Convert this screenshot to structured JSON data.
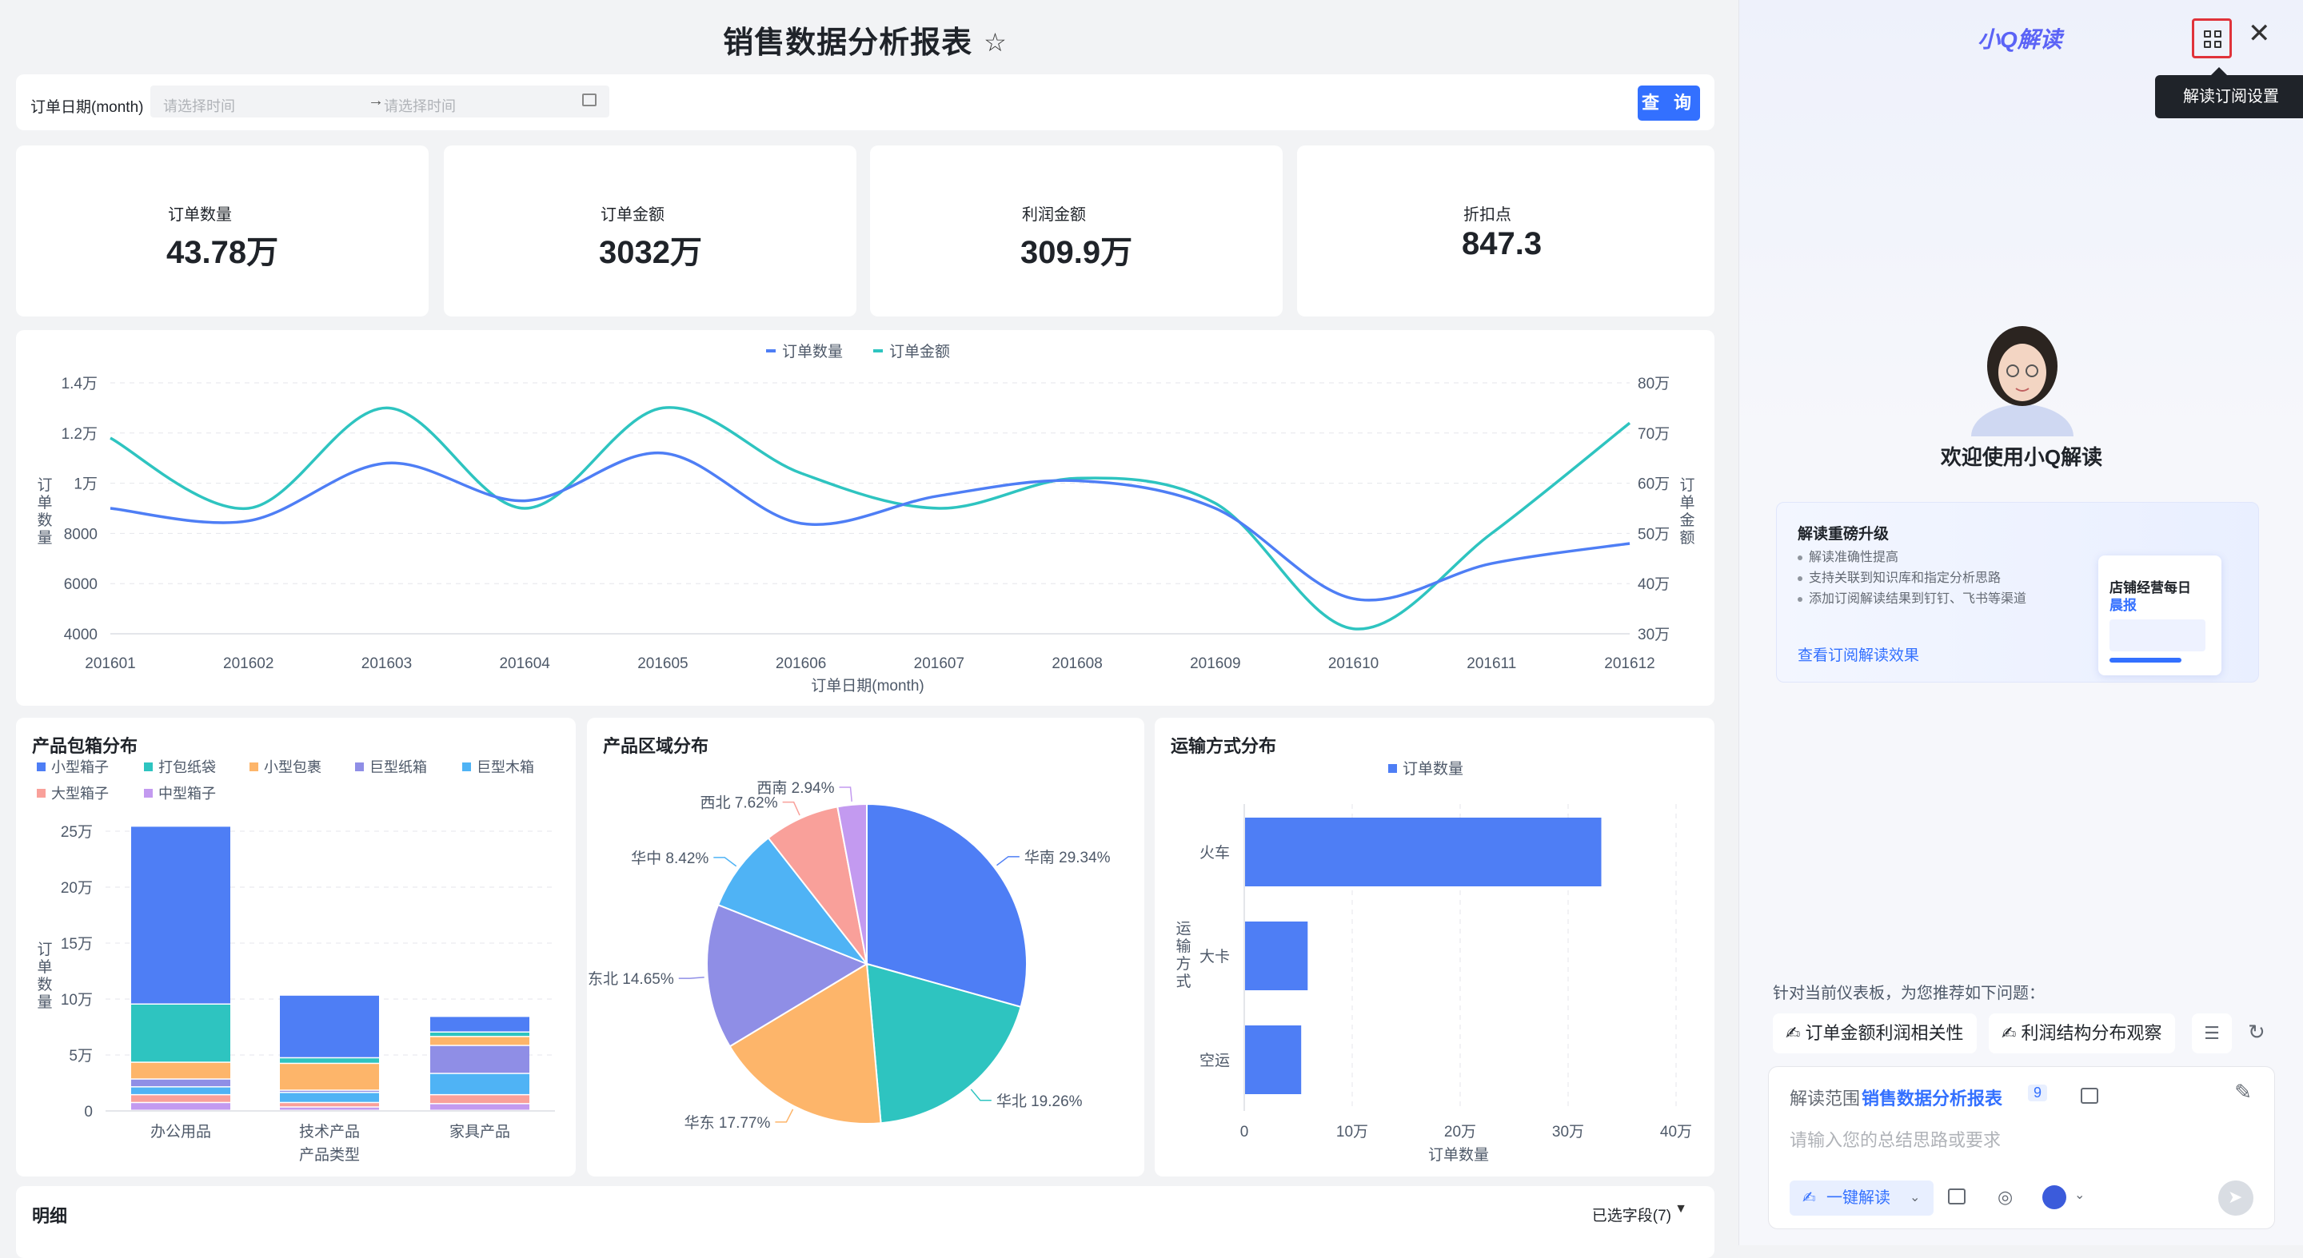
{
  "page": {
    "title": "销售数据分析报表"
  },
  "filter": {
    "label": "订单日期(month)",
    "start_placeholder": "请选择时间",
    "end_placeholder": "请选择时间",
    "query_label": "查 询"
  },
  "kpis": [
    {
      "label": "订单数量",
      "value": "43.78万"
    },
    {
      "label": "订单金额",
      "value": "3032万"
    },
    {
      "label": "利润金额",
      "value": "309.9万"
    },
    {
      "label": "折扣点",
      "value": "847.3"
    }
  ],
  "line_chart": {
    "legend": [
      "订单数量",
      "订单金额"
    ],
    "xlabel": "订单日期(month)",
    "ylabel_left": "订单数量",
    "ylabel_right": "订单金额",
    "xticks": [
      "201601",
      "201602",
      "201603",
      "201604",
      "201605",
      "201606",
      "201607",
      "201608",
      "201609",
      "201610",
      "201611",
      "201612"
    ],
    "yticks_left": [
      "1.4万",
      "1.2万",
      "1万",
      "8000",
      "6000",
      "4000"
    ],
    "yticks_right": [
      "80万",
      "70万",
      "60万",
      "50万",
      "40万",
      "30万"
    ]
  },
  "bar_chart": {
    "title": "产品包箱分布",
    "legend": [
      "小型箱子",
      "打包纸袋",
      "小型包裹",
      "巨型纸箱",
      "巨型木箱",
      "大型箱子",
      "中型箱子"
    ],
    "categories": [
      "办公用品",
      "技术产品",
      "家具产品"
    ],
    "xlabel": "产品类型",
    "ylabel": "订单数量",
    "yticks": [
      "25万",
      "20万",
      "15万",
      "10万",
      "5万",
      "0"
    ]
  },
  "pie_chart": {
    "title": "产品区域分布",
    "labels": [
      "华南 29.34%",
      "华北 19.26%",
      "华东 17.77%",
      "东北 14.65%",
      "华中 8.42%",
      "西北 7.62%",
      "西南 2.94%"
    ]
  },
  "hbar_chart": {
    "title": "运输方式分布",
    "legend": [
      "订单数量"
    ],
    "categories": [
      "火车",
      "大卡",
      "空运"
    ],
    "xlabel": "订单数量",
    "ylabel": "运输方式",
    "xticks": [
      "0",
      "10万",
      "20万",
      "30万",
      "40万"
    ]
  },
  "detail": {
    "title": "明细",
    "fields": "已选字段(7)"
  },
  "panel": {
    "brand": "小Q解读",
    "tooltip": "解读订阅设置",
    "welcome": "欢迎使用小Q解读",
    "promo_title": "解读重磅升级",
    "promo_items": [
      "解读准确性提高",
      "支持关联到知识库和指定分析思路",
      "添加订阅解读结果到钉钉、飞书等渠道"
    ],
    "promo_link": "查看订阅解读效果",
    "promo_mock_line1": "店铺经营每日",
    "promo_mock_line2": "晨报",
    "suggest_label": "针对当前仪表板，为您推荐如下问题：",
    "chips": [
      "订单金额利润相关性",
      "利润结构分布观察"
    ],
    "scope_label": "解读范围",
    "scope_value": "销售数据分析报表",
    "scope_count": "9",
    "input_placeholder": "请输入您的总结思路或要求",
    "one_click": "一键解读"
  },
  "colors": {
    "blue": "#4e7ef5",
    "teal": "#2ec4c0",
    "orange": "#fdb56a",
    "purple": "#8f8ee6",
    "skyblue": "#4fb3f5",
    "pink": "#f9a09a",
    "violet": "#c39af0",
    "primary": "#3370ff"
  },
  "chart_data": [
    {
      "type": "line",
      "x": [
        "201601",
        "201602",
        "201603",
        "201604",
        "201605",
        "201606",
        "201607",
        "201608",
        "201609",
        "201610",
        "201611",
        "201612"
      ],
      "series": [
        {
          "name": "订单数量",
          "axis": "left",
          "values": [
            9000,
            8500,
            10800,
            9300,
            11200,
            8400,
            9500,
            10100,
            9000,
            5400,
            6800,
            7600
          ]
        },
        {
          "name": "订单金额",
          "axis": "right",
          "values": [
            690000,
            550000,
            750000,
            550000,
            750000,
            620000,
            550000,
            610000,
            560000,
            310000,
            500000,
            720000
          ]
        }
      ],
      "ylim_left": [
        4000,
        14000
      ],
      "ylim_right": [
        300000,
        800000
      ],
      "xlabel": "订单日期(month)",
      "ylabel": "订单数量",
      "y2label": "订单金额"
    },
    {
      "type": "bar",
      "stacked": true,
      "title": "产品包箱分布",
      "categories": [
        "办公用品",
        "技术产品",
        "家具产品"
      ],
      "series": [
        {
          "name": "中型箱子",
          "values": [
            7000,
            3000,
            6000
          ]
        },
        {
          "name": "大型箱子",
          "values": [
            7000,
            4000,
            8000
          ]
        },
        {
          "name": "巨型木箱",
          "values": [
            7000,
            9000,
            19000
          ]
        },
        {
          "name": "巨型纸箱",
          "values": [
            7000,
            2000,
            25000
          ]
        },
        {
          "name": "小型包裹",
          "values": [
            15000,
            24000,
            8000
          ]
        },
        {
          "name": "打包纸袋",
          "values": [
            52000,
            5000,
            4000
          ]
        },
        {
          "name": "小型箱子",
          "values": [
            159000,
            56000,
            14000
          ]
        }
      ],
      "ylim": [
        0,
        250000
      ],
      "xlabel": "产品类型",
      "ylabel": "订单数量"
    },
    {
      "type": "pie",
      "title": "产品区域分布",
      "labels": [
        "华南",
        "华北",
        "华东",
        "东北",
        "华中",
        "西北",
        "西南"
      ],
      "values": [
        29.34,
        19.26,
        17.77,
        14.65,
        8.42,
        7.62,
        2.94
      ]
    },
    {
      "type": "bar",
      "orientation": "horizontal",
      "title": "运输方式分布",
      "categories": [
        "火车",
        "大卡",
        "空运"
      ],
      "series": [
        {
          "name": "订单数量",
          "values": [
            330000,
            58000,
            52000
          ]
        }
      ],
      "xlim": [
        0,
        400000
      ],
      "xlabel": "订单数量",
      "ylabel": "运输方式"
    }
  ]
}
